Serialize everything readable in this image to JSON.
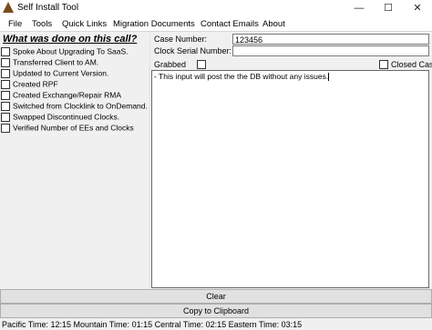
{
  "window": {
    "title": "Self Install Tool",
    "minimize_glyph": "—",
    "maximize_glyph": "☐",
    "close_glyph": "✕"
  },
  "menu": [
    "File",
    "Tools",
    "Quick Links",
    "Migration Documents",
    "Contact Emails",
    "About"
  ],
  "left_panel": {
    "heading": "What was done on this call?",
    "checklist": [
      "Spoke About Upgrading To SaaS.",
      "Transferred Client to AM.",
      "Updated to Current Version.",
      "Created RPF",
      "Created Exchange/Repair RMA",
      "Switched from Clocklink to OnDemand.",
      "Swapped Discontinued Clocks.",
      "Verified Number of EEs and Clocks"
    ]
  },
  "form": {
    "case_number_label": "Case Number:",
    "case_number_value": "123456",
    "clock_serial_label": "Clock Serial Number:",
    "clock_serial_value": "",
    "grabbed_label": "Grabbed",
    "grabbed_checked": false,
    "closed_case_label": "Closed Case.",
    "closed_case_checked": false,
    "notes_text": "- This input will post the the DB without any issues."
  },
  "buttons": {
    "clear_label": "Clear",
    "copy_label": "Copy to Clipboard"
  },
  "status_bar": {
    "text": "Pacific Time: 12:15  Mountain Time: 01:15  Central Time: 02:15  Eastern Time: 03:15"
  },
  "colors": {
    "icon": "#7a4a1e",
    "window_bg": "#f0f0f0",
    "button_bg": "#e1e1e1"
  }
}
